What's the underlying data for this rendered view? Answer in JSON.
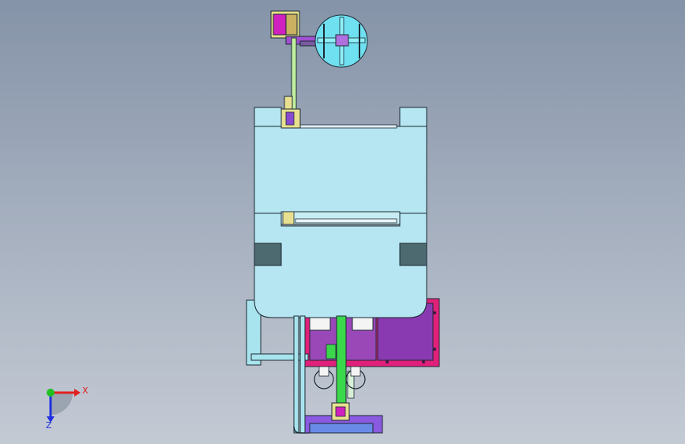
{
  "triad": {
    "x_label": "X",
    "z_label": "Z",
    "x_color": "#e02020",
    "y_color": "#20c020",
    "z_color": "#2030e0"
  },
  "colors": {
    "body": "#b5e6f2",
    "outline": "#1c2a33",
    "dark_slot": "#4d6a70",
    "magenta": "#e0207a",
    "purple": "#8a3ab0",
    "green": "#3ad84a",
    "yellow": "#e8e060",
    "blue": "#6a8ae8"
  }
}
